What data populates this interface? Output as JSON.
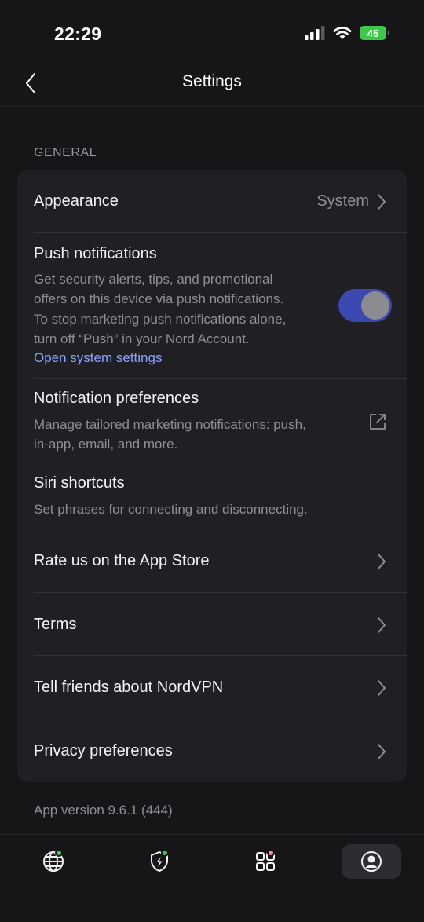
{
  "status_bar": {
    "time": "22:29",
    "battery": "45"
  },
  "nav": {
    "title": "Settings"
  },
  "section": {
    "header": "GENERAL"
  },
  "rows": {
    "appearance": {
      "title": "Appearance",
      "value": "System"
    },
    "push": {
      "title": "Push notifications",
      "desc_lines": [
        "Get security alerts, tips, and promotional",
        "offers on this device via push notifications.",
        "To stop marketing push notifications alone,",
        "turn off “Push” in your Nord Account."
      ],
      "link": "Open system settings",
      "enabled": true
    },
    "notif_prefs": {
      "title": "Notification preferences",
      "desc_lines": [
        "Manage tailored marketing notifications: push,",
        "in-app, email, and more."
      ]
    },
    "siri": {
      "title": "Siri shortcuts",
      "desc": "Set phrases for connecting and disconnecting."
    },
    "rate": {
      "title": "Rate us on the App Store"
    },
    "terms": {
      "title": "Terms"
    },
    "tell_friends": {
      "title": "Tell friends about NordVPN"
    },
    "privacy": {
      "title": "Privacy preferences"
    }
  },
  "footer": {
    "app_version": "App version 9.6.1 (444)"
  },
  "tabs": [
    {
      "icon": "globe-icon",
      "badge_color": "#3ec84a",
      "active": false
    },
    {
      "icon": "shield-bolt-icon",
      "badge_color": "#3ec84a",
      "active": false
    },
    {
      "icon": "apps-grid-icon",
      "badge_color": "#ff8a8a",
      "active": false
    },
    {
      "icon": "profile-icon",
      "badge_color": "",
      "active": true
    }
  ],
  "colors": {
    "background": "#161619",
    "card": "#202024",
    "accent_link": "#8aa2ff",
    "toggle_on": "#3a48b0",
    "badge_green": "#3ec84a",
    "badge_red": "#ff8a8a"
  }
}
